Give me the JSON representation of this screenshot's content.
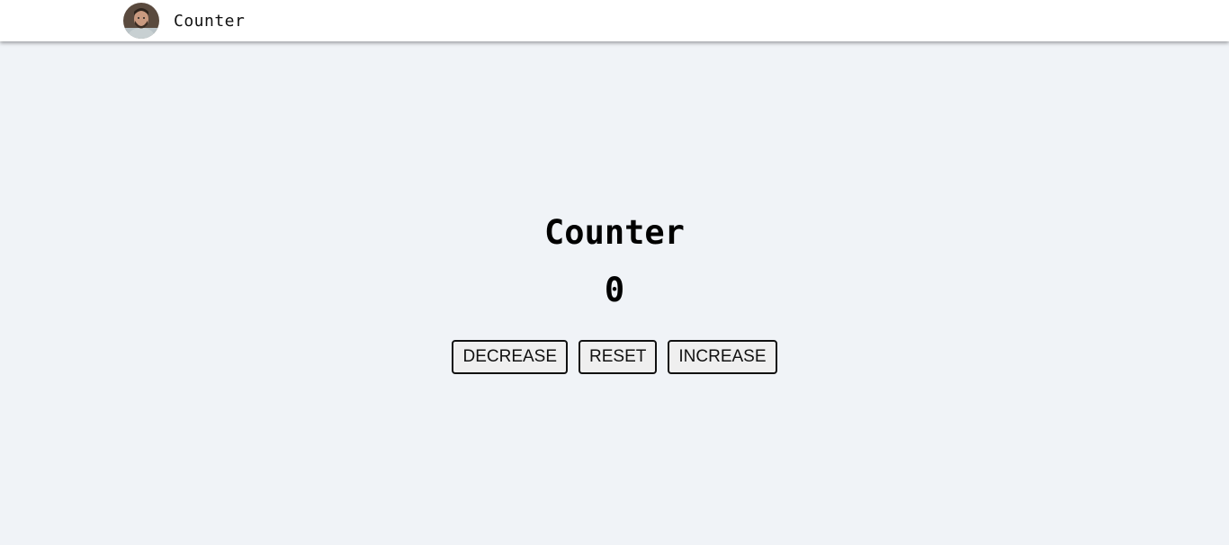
{
  "nav": {
    "brand": "Counter",
    "avatar_icon": "profile-photo"
  },
  "counter": {
    "title": "Counter",
    "value": "0"
  },
  "buttons": {
    "decrease": "DECREASE",
    "reset": "RESET",
    "increase": "INCREASE"
  },
  "colors": {
    "background": "#f0f3f7",
    "navbar": "#ffffff",
    "button_bg": "#efefef",
    "button_border": "#111111"
  }
}
